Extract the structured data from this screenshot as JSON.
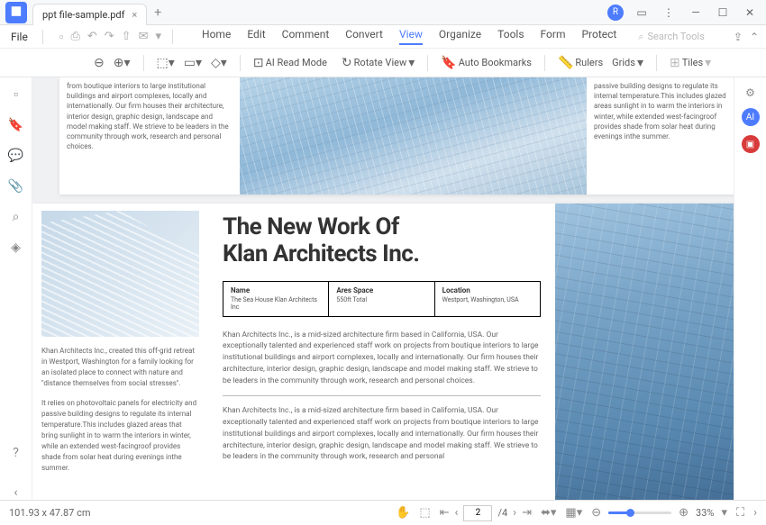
{
  "titlebar": {
    "tab_label": "ppt file-sample.pdf",
    "avatar": "R"
  },
  "menubar": {
    "file": "File",
    "main": [
      "Home",
      "Edit",
      "Comment",
      "Convert",
      "View",
      "Organize",
      "Tools",
      "Form",
      "Protect"
    ],
    "active_index": 4,
    "search_placeholder": "Search Tools"
  },
  "toolbar": {
    "ai_read": "AI Read Mode",
    "rotate": "Rotate View",
    "auto_bookmarks": "Auto Bookmarks",
    "rulers": "Rulers",
    "grids": "Grids",
    "tiles": "Tiles"
  },
  "doc": {
    "frag1_left": "from boutique interiors to large institutional buildings and airport complexes, locally and internationally. Our firm houses their architecture, interior design, graphic design, landscape and model making staff. We strieve to be leaders in the community through work, research and personal choices.",
    "frag1_right": "passive building designs to regulate its internal temperature.This includes glazed areas sunlight in to warm the interiors in winter, while extended west-facingroof provides shade from solar heat during evenings inthe summer.",
    "title_l1": "The New Work Of",
    "title_l2": "Klan Architects Inc.",
    "info": [
      {
        "hd": "Name",
        "bd": "The Sea House Klan Architects Inc"
      },
      {
        "hd": "Ares Space",
        "bd": "550ft Total"
      },
      {
        "hd": "Location",
        "bd": "Westport, Washington, USA"
      }
    ],
    "left_p1": "Khan Architects Inc., created this off-grid retreat in Westport, Washington for a family looking for an isolated place to connect with nature and \"distance themselves from social stresses\".",
    "left_p2": "It relies on photovoltaic panels for electricity and passive building designs to regulate its internal temperature.This includes glazed areas that bring sunlight in to warm the interiors in winter, while an extended west-facingroof provides shade from solar heat during evenings inthe summer.",
    "body_p1": "Khan Architects Inc., is a mid-sized architecture firm based in California, USA. Our exceptionally talented and experienced staff work on projects from boutique interiors to large institutional buildings and airport complexes, locally and internationally. Our firm houses their architecture, interior design, graphic design, landscape and model making staff. We strieve to be leaders in the community through work, research and personal choices.",
    "body_p2": "Khan Architects Inc., is a mid-sized architecture firm based in California, USA. Our exceptionally talented and experienced staff work on projects from boutique interiors to large institutional buildings and airport complexes, locally and internationally. Our firm houses their architecture, interior design, graphic design, landscape and model making staff. We strieve to be leaders in the community through work, research and personal"
  },
  "status": {
    "coords": "101.93 x 47.87 cm",
    "page_current": "2",
    "page_total": "/4",
    "zoom": "33%"
  }
}
